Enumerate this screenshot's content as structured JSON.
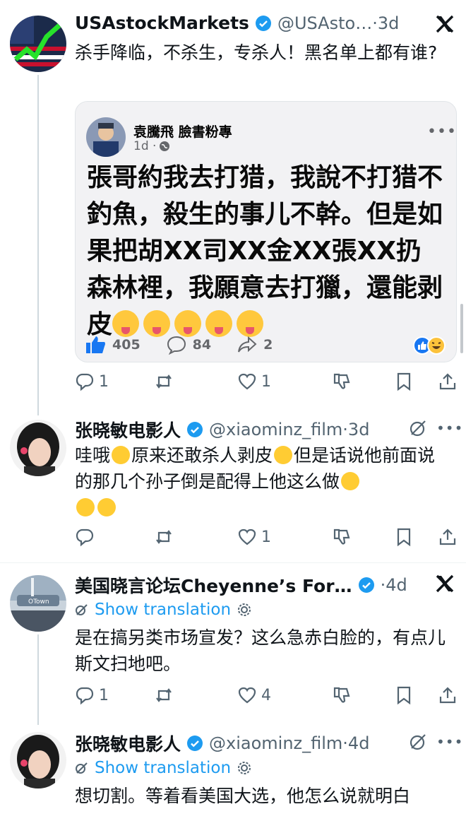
{
  "tweets": [
    {
      "name": "USAstockMarkets",
      "handle_time": "@USAsto…·3d",
      "text": "杀手降临，不杀生，专杀人！黑名单上都有谁?",
      "actions": {
        "reply": "1",
        "retweet": "",
        "like": "1"
      },
      "quoted": {
        "page_name": "袁騰飛 臉書粉專",
        "time": "1d ·",
        "post_text": "張哥約我去打猎，我說不打猎不釣魚，殺生的事儿不幹。但是如果把胡XX司XX金XX張XX扔森林裡，我願意去打獵，還能剥皮",
        "likes": "405",
        "comments": "84",
        "shares": "2"
      }
    },
    {
      "name": "张晓敏电影人",
      "handle_time": "@xiaominz_film·3d",
      "text_a": "哇哦",
      "text_b": "原来还敢杀人剥皮",
      "text_c": "但是话说他前面说的那几个孙子倒是配得上他这么做",
      "actions": {
        "reply": "",
        "retweet": "",
        "like": "1"
      }
    },
    {
      "name": "美国晓言论坛Cheyenne’s For…",
      "handle_time": "·4d",
      "translate": "Show translation",
      "text": "是在搞另类市场宣发？这么急赤白脸的，有点儿斯文扫地吧。",
      "actions": {
        "reply": "1",
        "retweet": "",
        "like": "4"
      }
    },
    {
      "name": "张晓敏电影人",
      "handle_time": "@xiaominz_film·4d",
      "translate": "Show translation",
      "text": "想切割。等着看美国大选，他怎么说就明白"
    }
  ],
  "colors": {
    "link": "#1d9bf0",
    "muted": "#536471",
    "verified": "#1d9bf0",
    "fb_blue": "#1877f2"
  }
}
